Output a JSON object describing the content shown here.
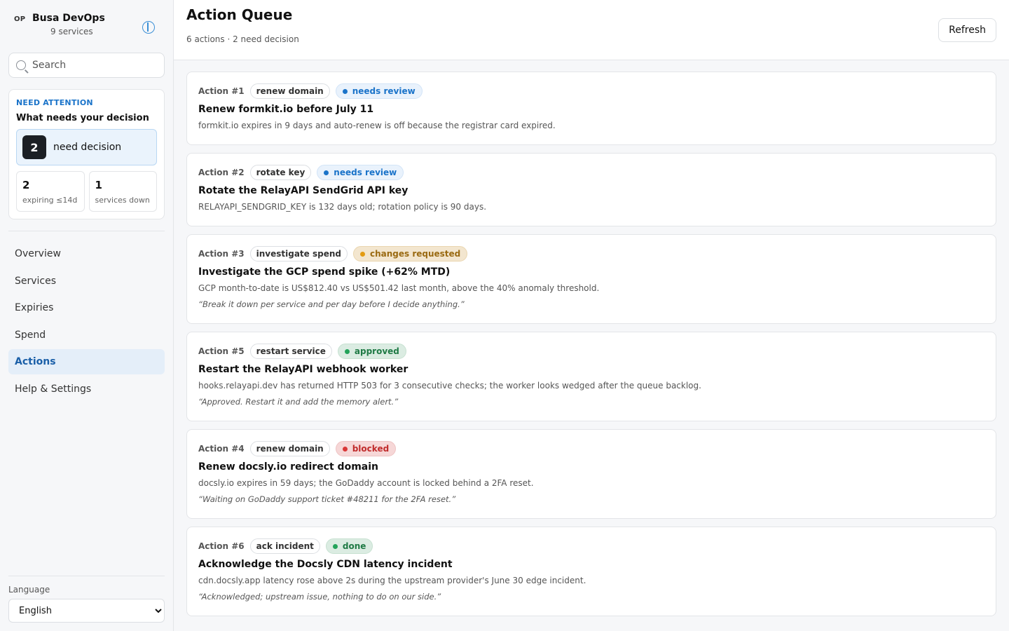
{
  "brand": {
    "badge": "OP",
    "name": "Busa DevOps",
    "subtitle": "9 services"
  },
  "search": {
    "placeholder": "Search"
  },
  "attention": {
    "eyebrow": "NEED ATTENTION",
    "title": "What needs your decision",
    "decision_count": "2",
    "decision_label": "need decision",
    "stats": [
      {
        "value": "2",
        "label": "expiring ≤14d"
      },
      {
        "value": "1",
        "label": "services down"
      }
    ]
  },
  "nav": {
    "items": [
      {
        "label": "Overview"
      },
      {
        "label": "Services"
      },
      {
        "label": "Expiries"
      },
      {
        "label": "Spend"
      },
      {
        "label": "Actions",
        "active": true
      },
      {
        "label": "Help & Settings"
      }
    ]
  },
  "language": {
    "label": "Language",
    "selected": "English"
  },
  "header": {
    "title": "Action Queue",
    "subtitle": "6 actions · 2 need decision",
    "refresh_label": "Refresh"
  },
  "actions": [
    {
      "num": "Action #1",
      "type": "renew domain",
      "status": "needs review",
      "title": "Renew formkit.io before July 11",
      "desc": "formkit.io expires in 9 days and auto-renew is off because the registrar card expired.",
      "note": ""
    },
    {
      "num": "Action #2",
      "type": "rotate key",
      "status": "needs review",
      "title": "Rotate the RelayAPI SendGrid API key",
      "desc": "RELAYAPI_SENDGRID_KEY is 132 days old; rotation policy is 90 days.",
      "note": ""
    },
    {
      "num": "Action #3",
      "type": "investigate spend",
      "status": "changes requested",
      "title": "Investigate the GCP spend spike (+62% MTD)",
      "desc": "GCP month-to-date is US$812.40 vs US$501.42 last month, above the 40% anomaly threshold.",
      "note": "“Break it down per service and per day before I decide anything.”"
    },
    {
      "num": "Action #5",
      "type": "restart service",
      "status": "approved",
      "title": "Restart the RelayAPI webhook worker",
      "desc": "hooks.relayapi.dev has returned HTTP 503 for 3 consecutive checks; the worker looks wedged after the queue backlog.",
      "note": "“Approved. Restart it and add the memory alert.”"
    },
    {
      "num": "Action #4",
      "type": "renew domain",
      "status": "blocked",
      "title": "Renew docsly.io redirect domain",
      "desc": "docsly.io expires in 59 days; the GoDaddy account is locked behind a 2FA reset.",
      "note": "“Waiting on GoDaddy support ticket #48211 for the 2FA reset.”"
    },
    {
      "num": "Action #6",
      "type": "ack incident",
      "status": "done",
      "title": "Acknowledge the Docsly CDN latency incident",
      "desc": "cdn.docsly.app latency rose above 2s during the upstream provider's June 30 edge incident.",
      "note": "“Acknowledged; upstream issue, nothing to do on our side.”"
    }
  ],
  "status_colors": {
    "needs review": "#1a73c9",
    "changes requested": "#e39b12",
    "approved": "#23a35a",
    "blocked": "#d93636",
    "done": "#23a35a"
  }
}
